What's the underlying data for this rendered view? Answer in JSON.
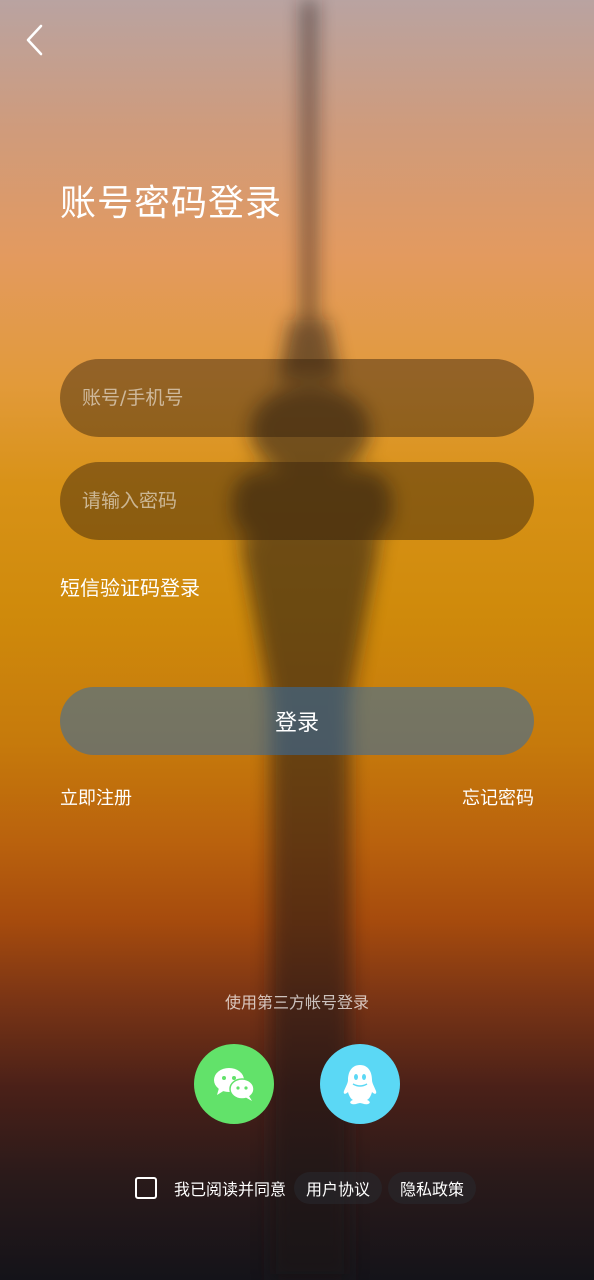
{
  "page": {
    "title": "账号密码登录"
  },
  "form": {
    "account_placeholder": "账号/手机号",
    "password_placeholder": "请输入密码",
    "sms_login": "短信验证码登录",
    "login_button": "登录",
    "register": "立即注册",
    "forgot_password": "忘记密码"
  },
  "third_party": {
    "label": "使用第三方帐号登录",
    "icons": [
      "wechat-icon",
      "qq-icon"
    ]
  },
  "agreement": {
    "text": "我已阅读并同意",
    "user_agreement": "用户协议",
    "privacy_policy": "隐私政策",
    "checked": false
  },
  "colors": {
    "wechat": "#62e26a",
    "qq": "#5bd8f5",
    "login_button": "#3f6ea0"
  }
}
